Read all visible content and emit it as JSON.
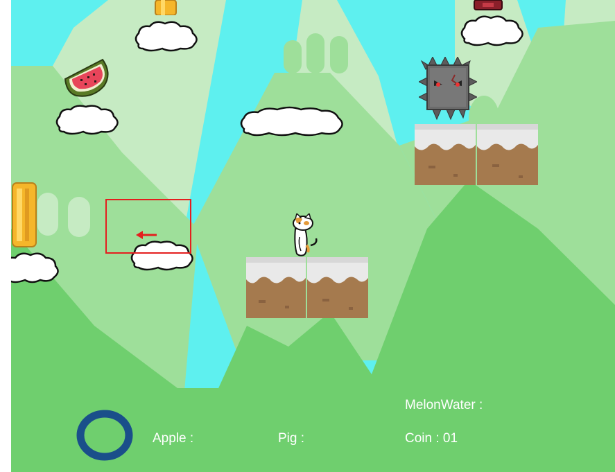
{
  "hud": {
    "labels": {
      "melonwater": "MelonWater :",
      "apple": "Apple :",
      "pig": "Pig :",
      "coin": "Coin : 01"
    },
    "joystick": "ring-button"
  },
  "colors": {
    "sky": "#5ef0ef",
    "hill_far": "#c6ebc3",
    "hill_mid": "#9edf9a",
    "hill_near": "#6fcf6e",
    "ground": "#6fcf6e",
    "snow": "#e9e9e9",
    "dirt": "#a57a4e",
    "joystick_ring": "#1a4f8a",
    "selection": "#e41e1e"
  },
  "icons": {
    "player": "cat-icon",
    "enemy": "spiked-block-icon",
    "pickup_fruit": "watermelon-slice-icon",
    "pickup_coin": "coin-icon",
    "arrow": "arrow-left-icon"
  }
}
